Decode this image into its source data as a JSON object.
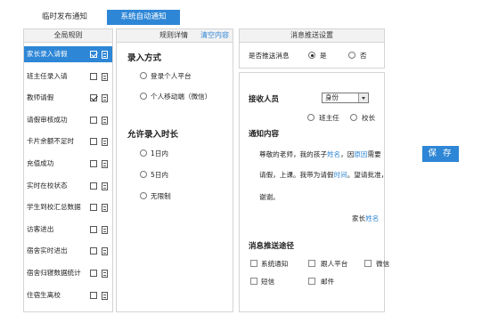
{
  "tabs": [
    {
      "label": "临时发布通知",
      "active": false
    },
    {
      "label": "系统自动通知",
      "active": true
    }
  ],
  "colors": {
    "accent": "#2e86d6"
  },
  "left_panel": {
    "header": "全局规则",
    "items": [
      {
        "label": "家长录入请假",
        "checked": true,
        "active": true
      },
      {
        "label": "班主任录入请",
        "checked": false,
        "active": false
      },
      {
        "label": "教师请假",
        "checked": true,
        "active": false
      },
      {
        "label": "请假审核成功",
        "checked": false,
        "active": false
      },
      {
        "label": "卡片余额不足时",
        "checked": false,
        "active": false
      },
      {
        "label": "充值成功",
        "checked": false,
        "active": false
      },
      {
        "label": "实时在校状态",
        "checked": false,
        "active": false
      },
      {
        "label": "学生到校汇总数据",
        "checked": false,
        "active": false
      },
      {
        "label": "访客进出",
        "checked": false,
        "active": false
      },
      {
        "label": "宿舍实时进出",
        "checked": false,
        "active": false
      },
      {
        "label": "宿舍归寝数据统计",
        "checked": false,
        "active": false
      },
      {
        "label": "住宿生离校",
        "checked": false,
        "active": false
      }
    ]
  },
  "mid_panel": {
    "header": "规则详情",
    "clear_link": "清空内容",
    "entry_method": {
      "title": "录入方式",
      "options": [
        "登录个人平台",
        "个人移动端（微信）"
      ]
    },
    "allow_time": {
      "title": "允许录入时长",
      "options": [
        "1日内",
        "5日内",
        "无限制"
      ]
    }
  },
  "push_settings": {
    "header": "消息推送设置",
    "label": "是否推送消息",
    "yes": "是",
    "no": "否",
    "selected": "是"
  },
  "receiver": {
    "label": "接收人员",
    "select_value": "身份",
    "options": [
      "班主任",
      "校长"
    ]
  },
  "notify": {
    "title": "通知内容",
    "line1_a": "尊敬的老师，我的孩子",
    "line1_b": "姓名",
    "line1_c": "，因",
    "line1_d": "原因",
    "line1_e": "需要",
    "line2_a": "请假，上课。我带为请假",
    "line2_b": "时间",
    "line2_c": "。望请批准，",
    "line3": "谢谢。",
    "sign_a": "家长",
    "sign_b": "姓名"
  },
  "route": {
    "title": "消息推送途径",
    "options": [
      "系统通知",
      "跟人平台",
      "微信",
      "短信",
      "邮件"
    ]
  },
  "save_label": "保 存"
}
